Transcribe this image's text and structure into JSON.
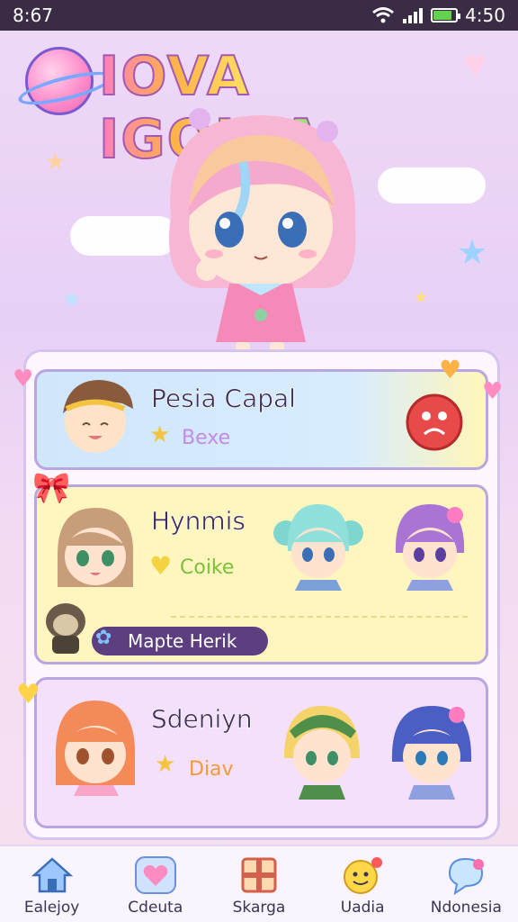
{
  "status_bar": {
    "time": "8:67",
    "clock": "4:50",
    "battery_level": 0.85
  },
  "app": {
    "title": "IOVA IGOKIA"
  },
  "cards": [
    {
      "title": "Pesia Capal",
      "subtitle": "Bexe",
      "subtitle_color": "#c38be8"
    },
    {
      "title": "Hynmis",
      "subtitle": "Coike",
      "subtitle_color": "#7bbf3a",
      "badge": "Mapte Herik"
    },
    {
      "title": "Sdeniyn",
      "subtitle": "Diav",
      "subtitle_color": "#f29a3a"
    }
  ],
  "nav": [
    {
      "label": "Ealejoy",
      "icon": "home-icon"
    },
    {
      "label": "Cdeuta",
      "icon": "heart-icon"
    },
    {
      "label": "Skarga",
      "icon": "gift-box-icon"
    },
    {
      "label": "Uadia",
      "icon": "smiley-chat-icon"
    },
    {
      "label": "Ndonesia",
      "icon": "chat-bubble-icon"
    }
  ],
  "colors": {
    "accent": "#b9a5df",
    "status_bar": "#3a2c44",
    "nav_bg": "#faf4ff"
  }
}
